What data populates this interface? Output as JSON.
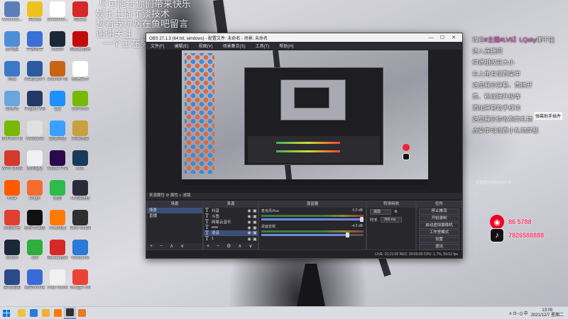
{
  "overlay_text": {
    "lines": [
      "尽可能给你们带来快乐",
      "娱乐主播不谈技术",
      "想看我玩啥在鱼吧留言",
      "谢谢关注",
      "一个正在努力18岁少女"
    ]
  },
  "desktop_icons": [
    {
      "label": "Windows...",
      "color": "#5a7fb8"
    },
    {
      "label": "向日葵",
      "color": "#f0c020"
    },
    {
      "label": "OneDrive...",
      "color": "#ffffff"
    },
    {
      "label": "网易云",
      "color": "#d62828"
    },
    {
      "label": "此电脑",
      "color": "#4f8fd8"
    },
    {
      "label": "手游助手",
      "color": "#3a6fd8"
    },
    {
      "label": "Steam",
      "color": "#1b2838"
    },
    {
      "label": "网易云音乐",
      "color": "#c20c0c"
    },
    {
      "label": "网络",
      "color": "#3c78c8"
    },
    {
      "label": "Wallpaper Engine",
      "color": "#2c5a9e"
    },
    {
      "label": "Counter-Strike",
      "color": "#c86414"
    },
    {
      "label": "新建文本",
      "color": "#ffffff"
    },
    {
      "label": "回收站",
      "color": "#6aa6e0"
    },
    {
      "label": "Project Winter",
      "color": "#243a66"
    },
    {
      "label": "QQ",
      "color": "#1e90ff"
    },
    {
      "label": "GeForce",
      "color": "#76b900"
    },
    {
      "label": "GeForce Experience",
      "color": "#76b900"
    },
    {
      "label": "WeGame",
      "color": "#e0e0e0"
    },
    {
      "label": "百度网盘",
      "color": "#3aa0ff"
    },
    {
      "label": "英雄联盟",
      "color": "#c8a040"
    },
    {
      "label": "WPS Office",
      "color": "#d43a2a"
    },
    {
      "label": "腾讯QQ",
      "color": "#f0f0f0"
    },
    {
      "label": "Adobe Premiere",
      "color": "#2a0a4a"
    },
    {
      "label": "LOL",
      "color": "#1a3a5a"
    },
    {
      "label": "Kwai",
      "color": "#ff5a00"
    },
    {
      "label": "Origin",
      "color": "#f56c2d"
    },
    {
      "label": "微信",
      "color": "#2bbc4a"
    },
    {
      "label": "UU加速器",
      "color": "#2a2a3a"
    },
    {
      "label": "火绒安全",
      "color": "#e04030"
    },
    {
      "label": "剪映专业版",
      "color": "#111111"
    },
    {
      "label": "斗鱼直播",
      "color": "#ff7a00"
    },
    {
      "label": "OBS Studio",
      "color": "#302e31"
    },
    {
      "label": "Steam",
      "color": "#1b2838"
    },
    {
      "label": "360",
      "color": "#2fae3c"
    },
    {
      "label": "网易云音乐",
      "color": "#d62828"
    },
    {
      "label": "WeGame",
      "color": "#2a7ad8"
    },
    {
      "label": "游戏加加",
      "color": "#2a4a8a"
    },
    {
      "label": "迅雷WeGame",
      "color": "#3a6ad8"
    },
    {
      "label": "Crab Game",
      "color": "#f0f0f0"
    },
    {
      "label": "Google Chrome",
      "color": "#ea4335"
    }
  ],
  "obs": {
    "title": "OBS 27.1.3 (64 bit, windows) - 配置文件: 未命名 - 场景: 未命名",
    "window_controls": [
      "—",
      "☐",
      "✕"
    ],
    "menu": [
      "文件(F)",
      "编辑(E)",
      "视图(V)",
      "场景集合(S)",
      "工具(T)",
      "帮助(H)"
    ],
    "filters_bar": "来源属性  ⚙ 属性  ◐ 滤镜",
    "scenes": {
      "title": "场景",
      "items": [
        "场景",
        "直播"
      ],
      "selected_index": 0,
      "footer": "+ − ∧ ∨"
    },
    "sources": {
      "title": "来源",
      "items": [
        {
          "name": "抖音"
        },
        {
          "name": "斗鱼"
        },
        {
          "name": "网易云音乐"
        },
        {
          "name": "eee"
        },
        {
          "name": "语音"
        },
        {
          "name": "1"
        }
      ],
      "selected_index": 4,
      "footer": "+ − ⚙ ∧ ∨"
    },
    "mixer": {
      "title": "混音器",
      "channels": [
        {
          "name": "麦克风/Aux",
          "level": "0.0 dB",
          "volume": 1.0
        },
        {
          "name": "桌面音频",
          "level": "-4.9 dB",
          "volume": 0.86
        }
      ]
    },
    "transitions": {
      "title": "转场特效",
      "type": "渐隐",
      "duration_label": "时长",
      "duration_value": "300 ms"
    },
    "controls": {
      "title": "控件",
      "buttons": [
        "停止推流",
        "开始录制",
        "启动虚拟摄像机",
        "工作室模式",
        "设置",
        "退出"
      ]
    },
    "status": "LIVE: 01:21:02   REC: 00:00:00   CPU: 1.7%, 59.52 fps"
  },
  "chat": {
    "lines": [
      {
        "prefix": "欢迎",
        "highlight": "#主播#LV5】LQsky",
        "suffix": "哪不能"
      },
      {
        "prefix": "进入直播间",
        "highlight": "",
        "suffix": ""
      },
      {
        "prefix": "伸近相改变大小",
        "highlight": "",
        "suffix": ""
      },
      {
        "prefix": "右上角有设置菜单",
        "highlight": "",
        "suffix": ""
      },
      {
        "prefix": "这里展示弹幕、贵族开",
        "highlight": "",
        "suffix": ""
      },
      {
        "prefix": "费、粉丝牌升级等",
        "highlight": "",
        "suffix": ""
      },
      {
        "prefix": "添加弹幕助手成功",
        "highlight": "",
        "suffix": ""
      },
      {
        "prefix": "这里展示你收到的礼物",
        "highlight": "",
        "suffix": ""
      },
      {
        "prefix": "点菜单可设置小礼物屏蔽",
        "highlight": "",
        "suffix": ""
      }
    ],
    "tag": "弹幕助手插件",
    "gift_hint": "这里展示你收到的礼物..."
  },
  "social": [
    {
      "icon": "netease-music-icon",
      "id": "86 5788",
      "color": "#ff3d6b"
    },
    {
      "icon": "douyin-icon",
      "id": "7826588888",
      "color": "#ff3d6b"
    }
  ],
  "taskbar": {
    "apps": [
      {
        "name": "explorer",
        "color": "#f0c040"
      },
      {
        "name": "edge",
        "color": "#2a7ad8"
      },
      {
        "name": "files",
        "color": "#f0b030"
      },
      {
        "name": "douyu",
        "color": "#ff7a00"
      },
      {
        "name": "obs",
        "color": "#302e31"
      },
      {
        "name": "orange-app",
        "color": "#e87a20"
      }
    ],
    "tray": "∧  ⊡  ◁)  中",
    "time": "13:05",
    "date": "2021/12/7 星期二"
  }
}
